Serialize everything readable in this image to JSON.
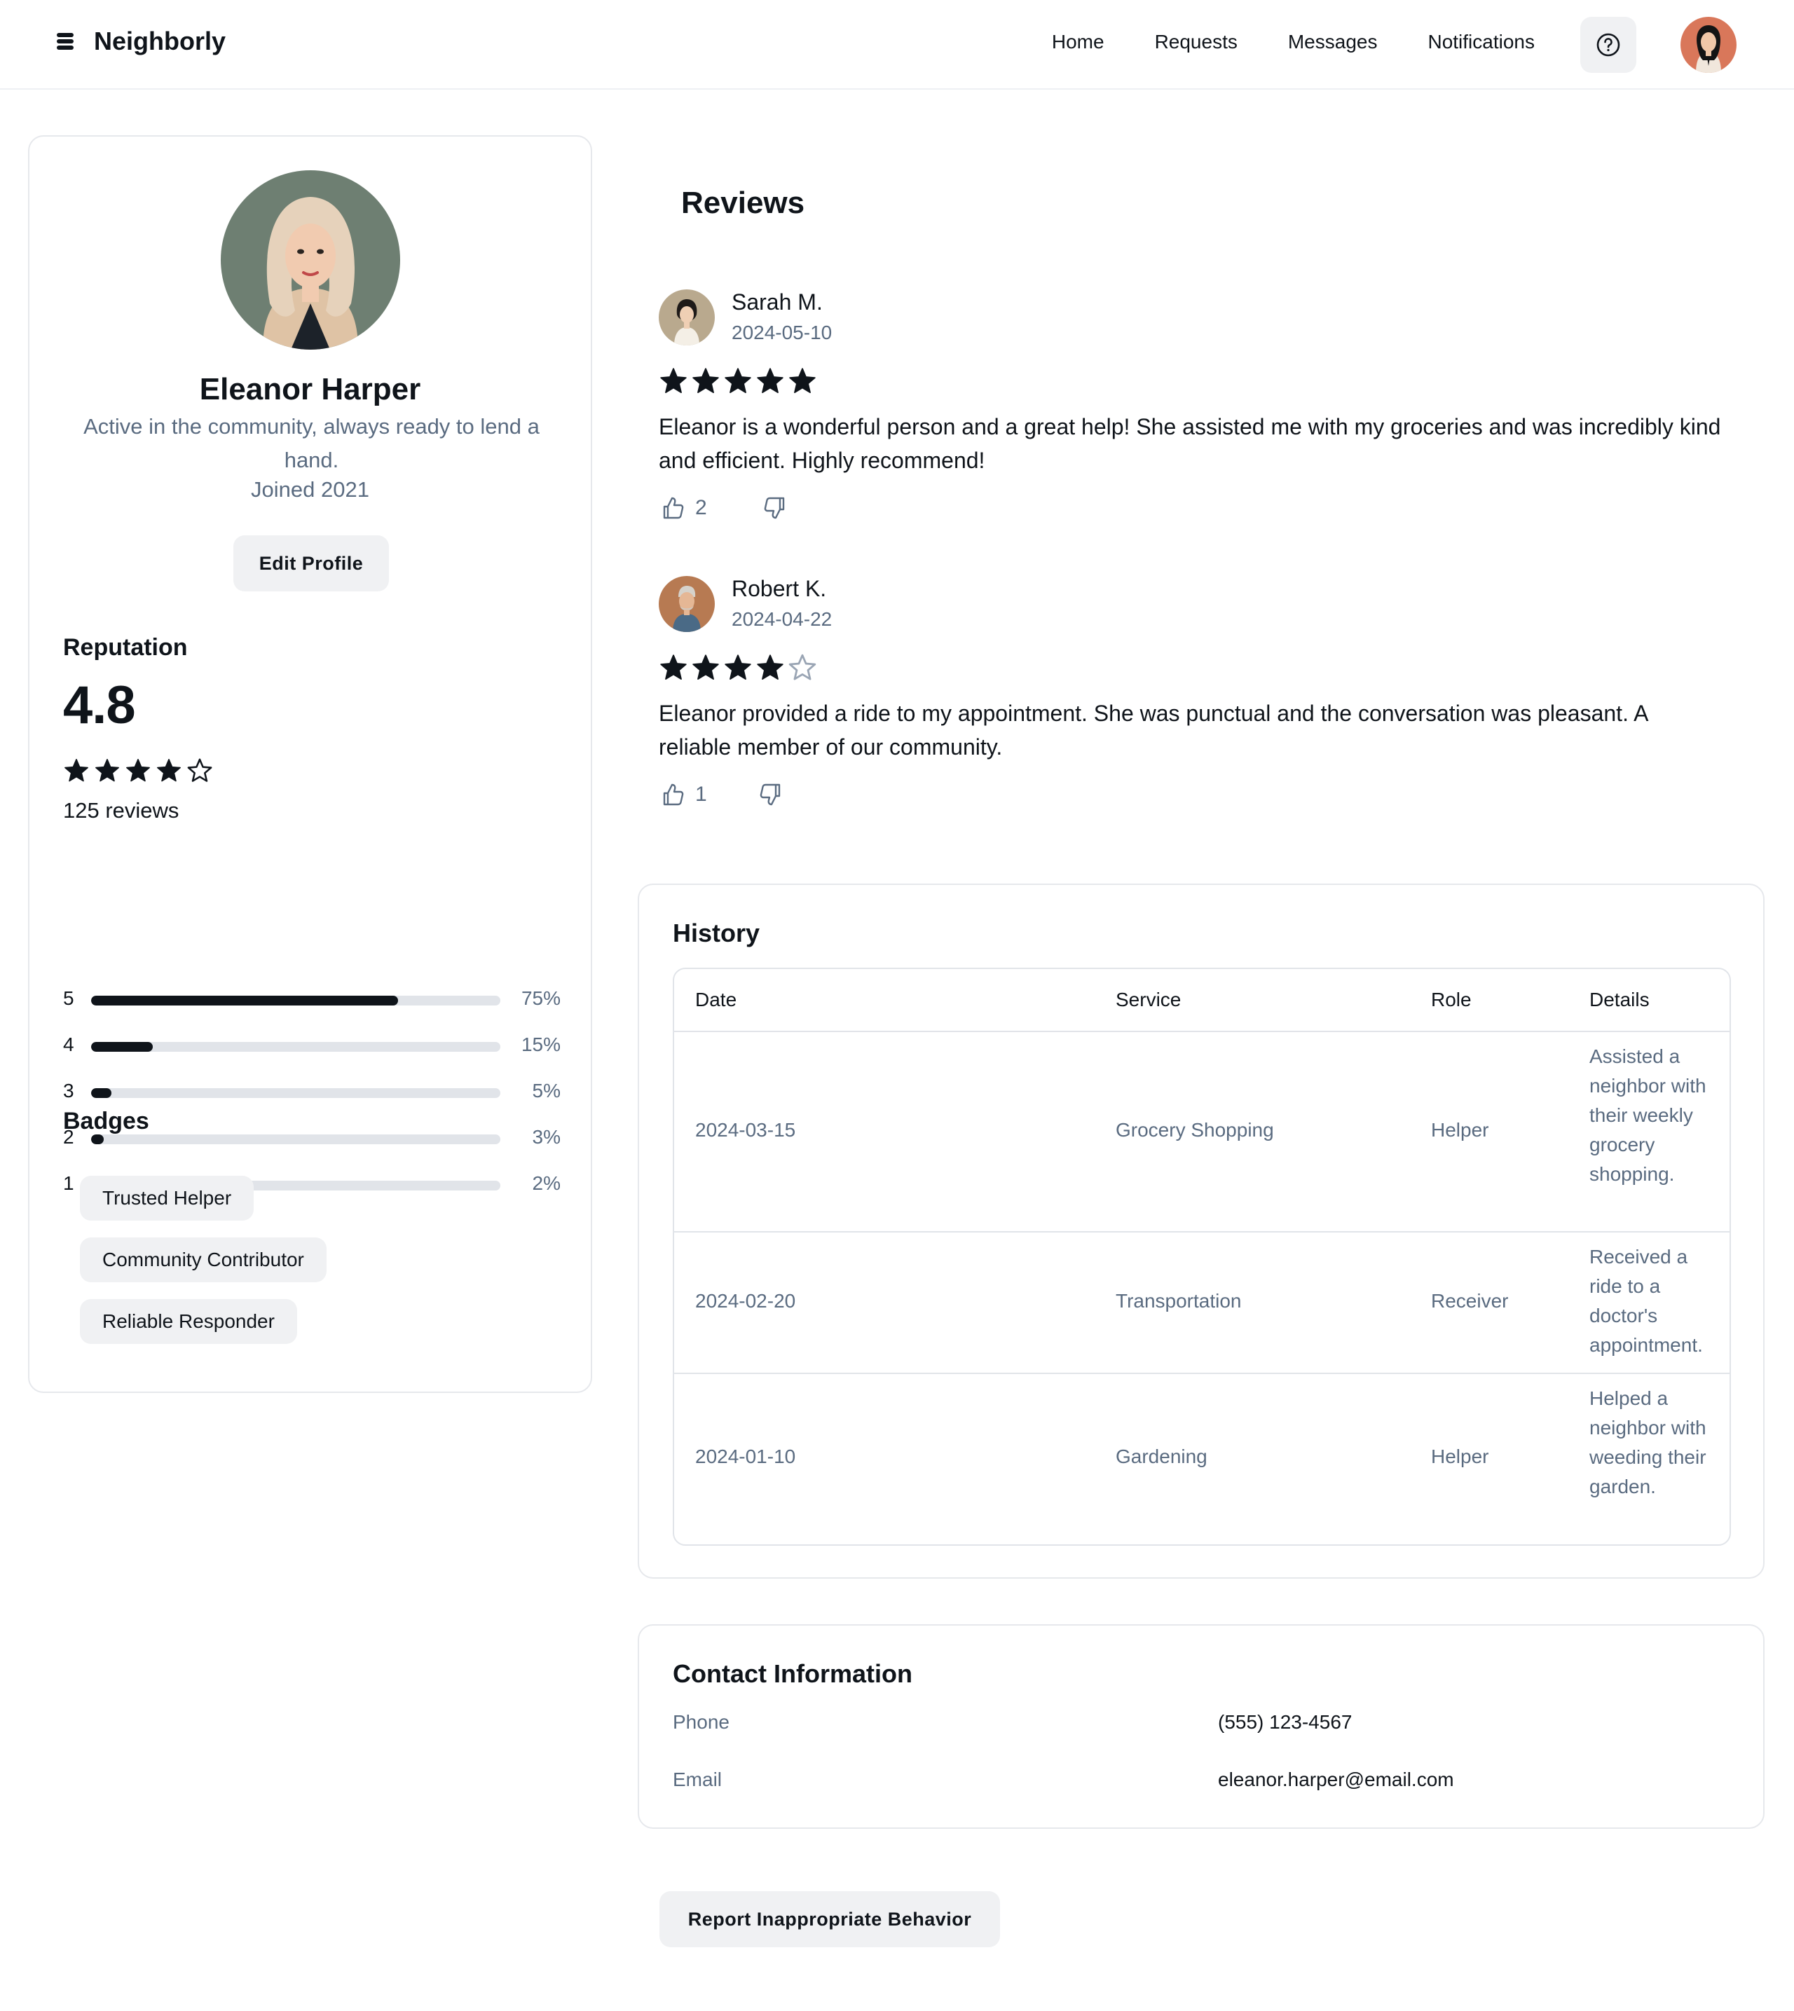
{
  "header": {
    "brand": "Neighborly",
    "nav": [
      "Home",
      "Requests",
      "Messages",
      "Notifications"
    ],
    "help_icon": "help-circle-icon"
  },
  "profile": {
    "name": "Eleanor Harper",
    "bio": "Active in the community, always ready to lend a hand.",
    "joined": "Joined 2021",
    "edit_label": "Edit Profile"
  },
  "reputation": {
    "title": "Reputation",
    "score": "4.8",
    "stars_filled": 4,
    "review_count": "125 reviews",
    "distribution": [
      {
        "label": "5",
        "pct_text": "75%",
        "value": 0.75
      },
      {
        "label": "4",
        "pct_text": "15%",
        "value": 0.15
      },
      {
        "label": "3",
        "pct_text": "5%",
        "value": 0.05
      },
      {
        "label": "2",
        "pct_text": "3%",
        "value": 0.03
      },
      {
        "label": "1",
        "pct_text": "2%",
        "value": 0.02
      }
    ]
  },
  "badges": {
    "title": "Badges",
    "items": [
      "Trusted Helper",
      "Community Contributor",
      "Reliable Responder"
    ]
  },
  "reviews": {
    "title": "Reviews",
    "items": [
      {
        "name": "Sarah M.",
        "date": "2024-05-10",
        "stars": 5,
        "text": "Eleanor is a wonderful person and a great help! She assisted me with my groceries and was incredibly kind and efficient. Highly recommend!",
        "likes": "2"
      },
      {
        "name": "Robert K.",
        "date": "2024-04-22",
        "stars": 4,
        "text": "Eleanor provided a ride to my appointment. She was punctual and the conversation was pleasant. A reliable member of our community.",
        "likes": "1"
      }
    ]
  },
  "history": {
    "title": "History",
    "columns": [
      "Date",
      "Service",
      "Role",
      "Details"
    ],
    "rows": [
      {
        "date": "2024-03-15",
        "service": "Grocery Shopping",
        "role": "Helper",
        "details": "Assisted a neighbor with their weekly grocery shopping."
      },
      {
        "date": "2024-02-20",
        "service": "Transportation",
        "role": "Receiver",
        "details": "Received a ride to a doctor's appointment."
      },
      {
        "date": "2024-01-10",
        "service": "Gardening",
        "role": "Helper",
        "details": "Helped a neighbor with weeding their garden."
      }
    ]
  },
  "contact": {
    "title": "Contact Information",
    "phone_label": "Phone",
    "phone": "(555) 123-4567",
    "email_label": "Email",
    "email": "eleanor.harper@email.com"
  },
  "report_label": "Report Inappropriate Behavior",
  "colors": {
    "text": "#0f141a",
    "muted": "#5a6b80",
    "surface": "#f0f1f3",
    "border": "#e6e8ec"
  }
}
